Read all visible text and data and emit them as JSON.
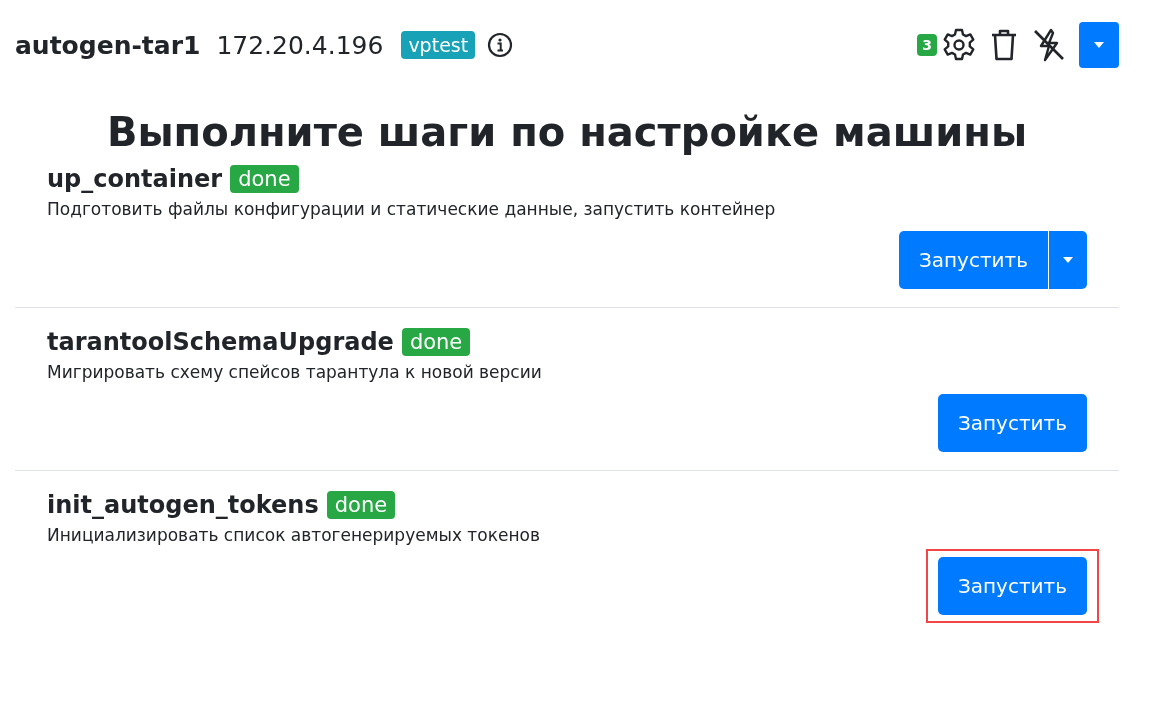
{
  "header": {
    "hostname": "autogen-tar1",
    "ip": "172.20.4.196",
    "tag": "vptest",
    "notification_count": "3"
  },
  "title": "Выполните шаги по настройке машины",
  "steps": [
    {
      "name": "up_container",
      "status": "done",
      "description": "Подготовить файлы конфигурации и статические данные, запустить контейнер",
      "button": "Запустить",
      "has_dropdown": true,
      "highlighted": false
    },
    {
      "name": "tarantoolSchemaUpgrade",
      "status": "done",
      "description": "Мигрировать схему спейсов тарантула к новой версии",
      "button": "Запустить",
      "has_dropdown": false,
      "highlighted": false
    },
    {
      "name": "init_autogen_tokens",
      "status": "done",
      "description": "Инициализировать список автогенерируемых токенов",
      "button": "Запустить",
      "has_dropdown": false,
      "highlighted": true
    }
  ]
}
